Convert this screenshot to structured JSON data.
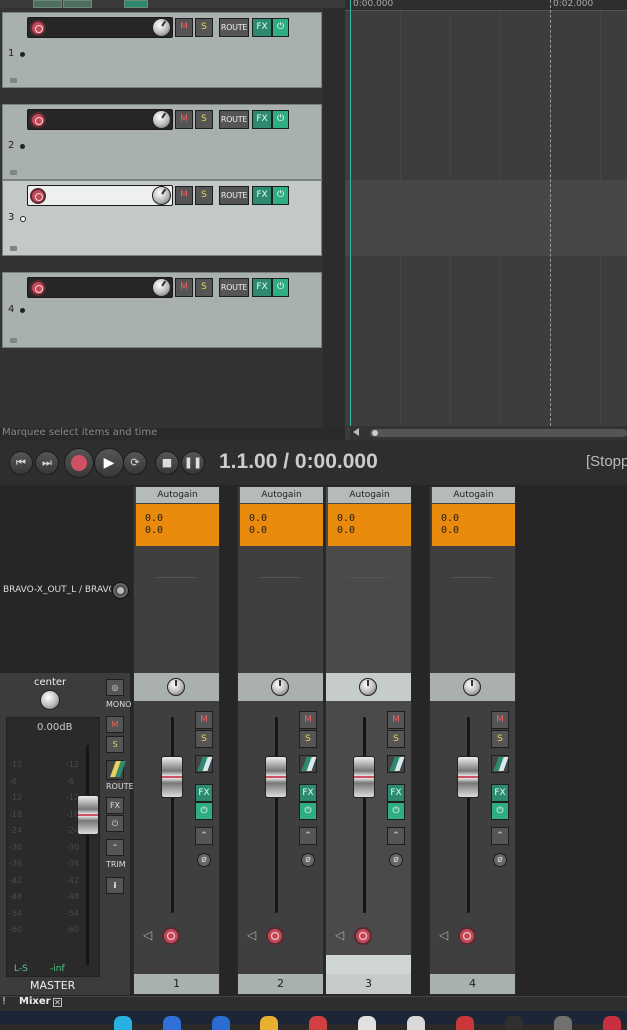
{
  "tracks": [
    {
      "number": "1"
    },
    {
      "number": "2"
    },
    {
      "number": "3"
    },
    {
      "number": "4"
    }
  ],
  "track_buttons": {
    "mute": "M",
    "solo": "S",
    "route": "ROUTE",
    "fx": "FX",
    "power": "⏻"
  },
  "status_text": "Marquee select items and time",
  "ruler": {
    "t0": "0:00.000",
    "t1": "0:02.000"
  },
  "transport": {
    "position": "1.1.00 / 0:00.000",
    "state": "[Stopp"
  },
  "mixer": {
    "fx_name": "Autogain",
    "fx_value_line1": "0.0",
    "fx_value_line2": "0.0",
    "channels": [
      {
        "number": "1"
      },
      {
        "number": "2"
      },
      {
        "number": "3"
      },
      {
        "number": "4"
      }
    ],
    "buttons": {
      "mute": "M",
      "solo": "S",
      "fx": "FX",
      "power": "⏻",
      "phase": "ø"
    }
  },
  "master": {
    "route_label": "BRAVO-X_OUT_L / BRAVO",
    "pan_label": "center",
    "volume_db": "0.00dB",
    "meter_left": "L-S",
    "meter_peak": "-inf",
    "label": "MASTER",
    "mono_label": "MONO",
    "route_label_small": "ROUTE",
    "trim_label": "TRIM",
    "mute": "M",
    "solo": "S",
    "fx": "FX",
    "power": "⏻",
    "info": "i",
    "scale": [
      "-12",
      "-6",
      "-12",
      "-18",
      "-24",
      "-30",
      "-36",
      "-42",
      "-48",
      "-54",
      "-60"
    ]
  },
  "tabs": {
    "excl": "!",
    "mixer": "Mixer",
    "close": "✕"
  },
  "colors": {
    "accent_teal": "#2fae84",
    "fx_orange": "#e98a0c",
    "record_red": "#c04a58",
    "cursor": "#38b8a8"
  }
}
